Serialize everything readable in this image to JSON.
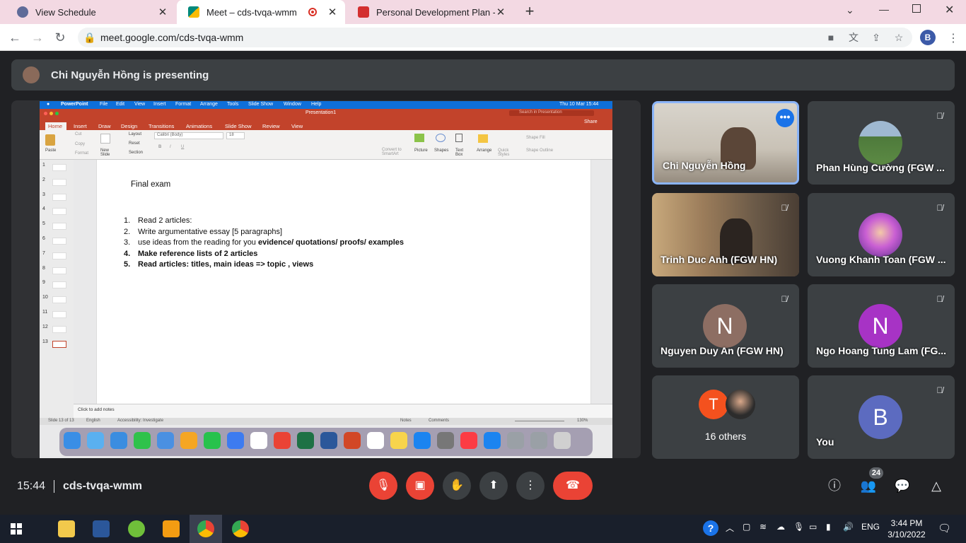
{
  "browser": {
    "tabs": [
      {
        "title": "View Schedule",
        "favicon_color": "#5f6b99"
      },
      {
        "title": "Meet – cds-tvqa-wmm",
        "favicon_color": "#00897b",
        "active": true
      },
      {
        "title": "Personal Development Plan - Def",
        "favicon_color": "#d32f2f"
      }
    ],
    "url": "meet.google.com/cds-tvqa-wmm",
    "profile_initial": "B"
  },
  "meet": {
    "presenting_banner": "Chi Nguyễn Hồng is presenting",
    "time": "15:44",
    "meeting_code": "cds-tvqa-wmm",
    "participant_count": "24",
    "participants": [
      {
        "name": "Chi Nguyễn Hồng",
        "type": "video",
        "speaking": true
      },
      {
        "name": "Phan Hùng Cường (FGW ...",
        "type": "photo",
        "muted": true
      },
      {
        "name": "Trinh Duc Anh (FGW HN)",
        "type": "video",
        "muted": true
      },
      {
        "name": "Vuong Khanh Toan (FGW ...",
        "type": "photo",
        "muted": true
      },
      {
        "name": "Nguyen Duy An (FGW HN)",
        "initial": "N",
        "color": "#8d6e63",
        "muted": true
      },
      {
        "name": "Ngo Hoang Tung Lam (FG...",
        "initial": "N",
        "color": "#a733c5",
        "muted": true
      },
      {
        "name": "You",
        "initial": "B",
        "color": "#5c6bc0",
        "muted": true
      }
    ],
    "others": {
      "label": "16 others",
      "initial": "T",
      "color": "#f4511e"
    }
  },
  "shared_screen": {
    "mac_menu": [
      "PowerPoint",
      "File",
      "Edit",
      "View",
      "Insert",
      "Format",
      "Arrange",
      "Tools",
      "Slide Show",
      "Window",
      "Help"
    ],
    "mac_clock": "Thu 10 Mar  15:44",
    "ppt_title": "Presentation1",
    "ppt_search": "Search in Presentation",
    "ppt_share": "Share",
    "ppt_tabs": [
      "Home",
      "Insert",
      "Draw",
      "Design",
      "Transitions",
      "Animations",
      "Slide Show",
      "Review",
      "View"
    ],
    "ribbon": {
      "paste": "Paste",
      "cut": "Cut",
      "copy": "Copy",
      "format": "Format",
      "new_slide": "New Slide",
      "layout": "Layout",
      "reset": "Reset",
      "section": "Section",
      "font": "Calibri (Body)",
      "size": "18",
      "convert": "Convert to SmartArt",
      "picture": "Picture",
      "shapes": "Shapes",
      "textbox": "Text Box",
      "arrange": "Arrange",
      "quick_styles": "Quick Styles",
      "shape_fill": "Shape Fill",
      "shape_outline": "Shape Outline"
    },
    "slide_numbers": [
      "1",
      "2",
      "3",
      "4",
      "5",
      "6",
      "7",
      "8",
      "9",
      "10",
      "11",
      "12",
      "13"
    ],
    "slide": {
      "title": "Final exam",
      "items": [
        {
          "num": "1.",
          "text": "Read 2 articles:",
          "bold": false
        },
        {
          "num": "2.",
          "text": "Write argumentative essay [5 paragraphs]",
          "bold": false
        },
        {
          "num": "3.",
          "text": "use ideas from the reading for you ",
          "bold_tail": "evidence/ quotations/ proofs/ examples",
          "bold": false
        },
        {
          "num": "4.",
          "text": "Make reference lists of 2 articles",
          "bold": true
        },
        {
          "num": "5.",
          "text": "Read articles: titles, main ideas => topic , views",
          "bold": true
        }
      ]
    },
    "notes_placeholder": "Click to add notes",
    "status": {
      "slide": "Slide 13 of 13",
      "lang": "English",
      "accessibility": "Accessibility: Investigate",
      "notes": "Notes",
      "comments": "Comments",
      "zoom": "130%"
    },
    "dock_calendar": {
      "month": "MAR",
      "day": "10"
    }
  },
  "taskbar": {
    "lang": "ENG",
    "time": "3:44 PM",
    "date": "3/10/2022"
  }
}
